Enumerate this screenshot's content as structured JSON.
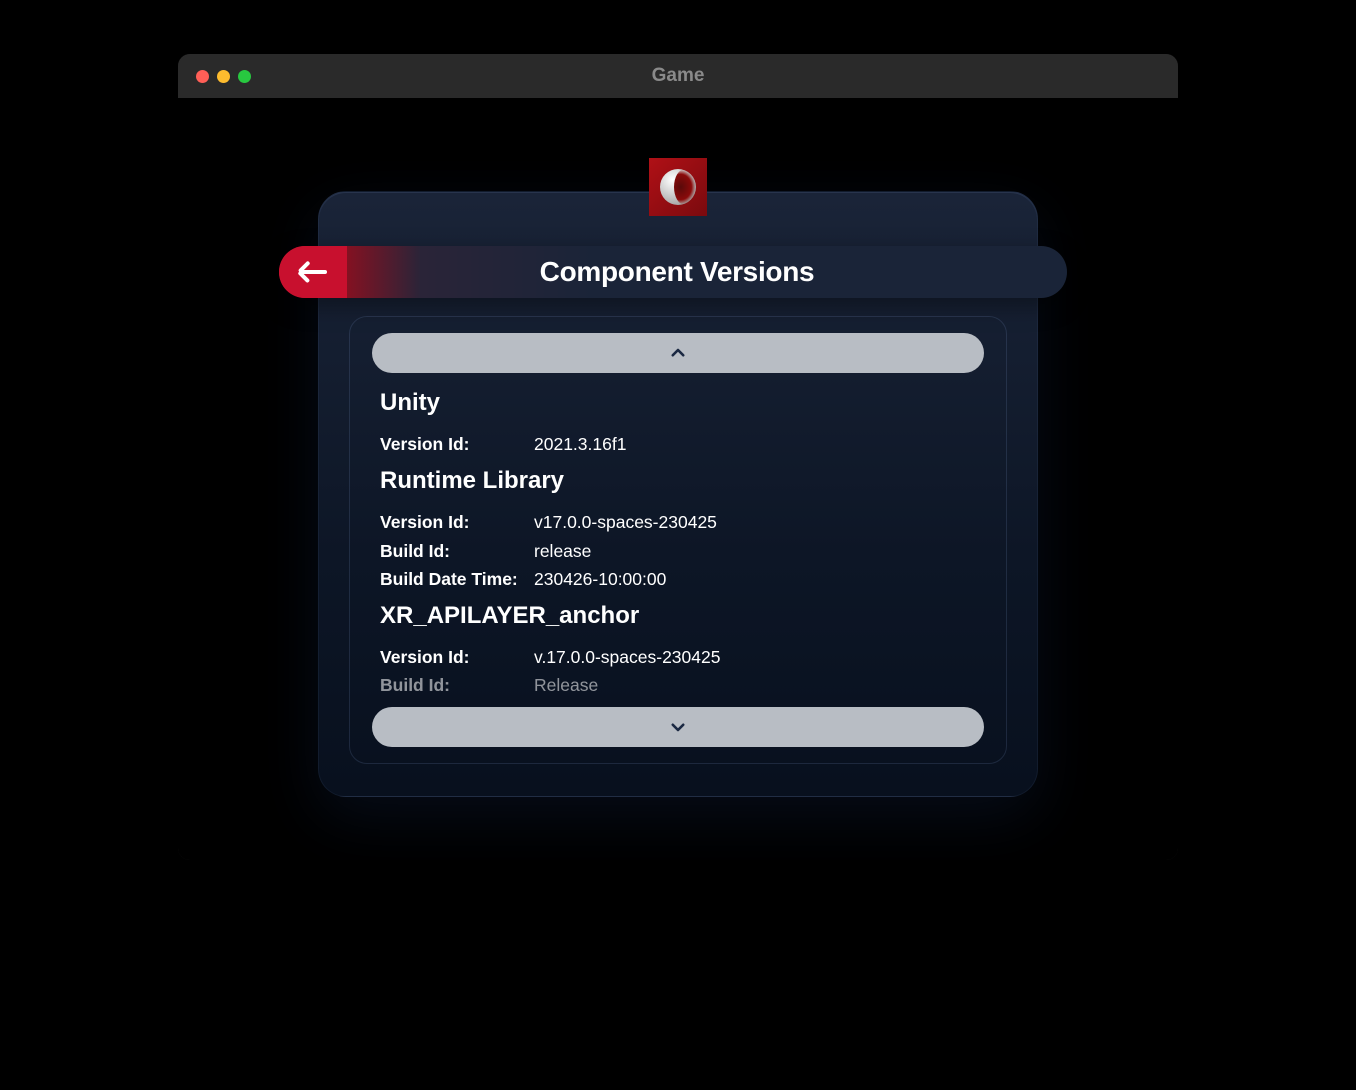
{
  "window": {
    "title": "Game"
  },
  "panel": {
    "header_title": "Component Versions"
  },
  "labels": {
    "version_id": "Version Id:",
    "build_id": "Build Id:",
    "build_date_time": "Build Date Time:"
  },
  "sections": {
    "unity": {
      "title": "Unity",
      "version_id": "2021.3.16f1"
    },
    "runtime": {
      "title": "Runtime Library",
      "version_id": "v17.0.0-spaces-230425",
      "build_id": "release",
      "build_date_time": "230426-10:00:00"
    },
    "apilayer": {
      "title": "XR_APILAYER_anchor",
      "version_id": "v.17.0.0-spaces-230425",
      "build_id": "Release"
    }
  }
}
